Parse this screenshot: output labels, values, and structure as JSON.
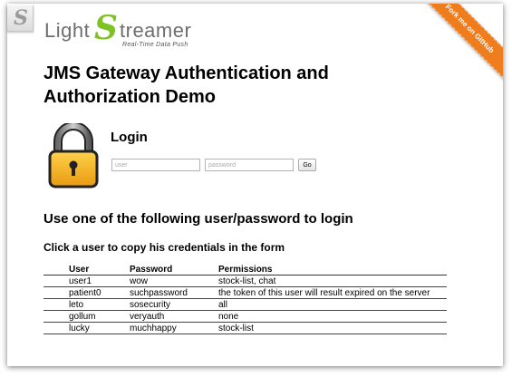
{
  "brand": {
    "logo_part1": "Light",
    "logo_part2": "S",
    "logo_part3": "treamer",
    "tagline": "Real-Time Data Push",
    "accent_color": "#7ec323"
  },
  "ribbon": {
    "label": "Fork me on GitHub",
    "color": "#f07d1d"
  },
  "page_title": "JMS Gateway Authentication and Authorization Demo",
  "login": {
    "title": "Login",
    "user_placeholder": "user",
    "password_placeholder": "password",
    "user_value": "",
    "password_value": "",
    "go_label": "Go",
    "icon": "padlock-icon"
  },
  "instructions": {
    "heading": "Use one of the following user/password to login",
    "subheading": "Click a user to copy his credentials in the form"
  },
  "users_table": {
    "headers": [
      "User",
      "Password",
      "Permissions"
    ],
    "rows": [
      [
        "user1",
        "wow",
        "stock-list, chat"
      ],
      [
        "patient0",
        "suchpassword",
        "the token of this user will result expired on the server"
      ],
      [
        "leto",
        "sosecurity",
        "all"
      ],
      [
        "gollum",
        "veryauth",
        "none"
      ],
      [
        "lucky",
        "muchhappy",
        "stock-list"
      ]
    ]
  }
}
